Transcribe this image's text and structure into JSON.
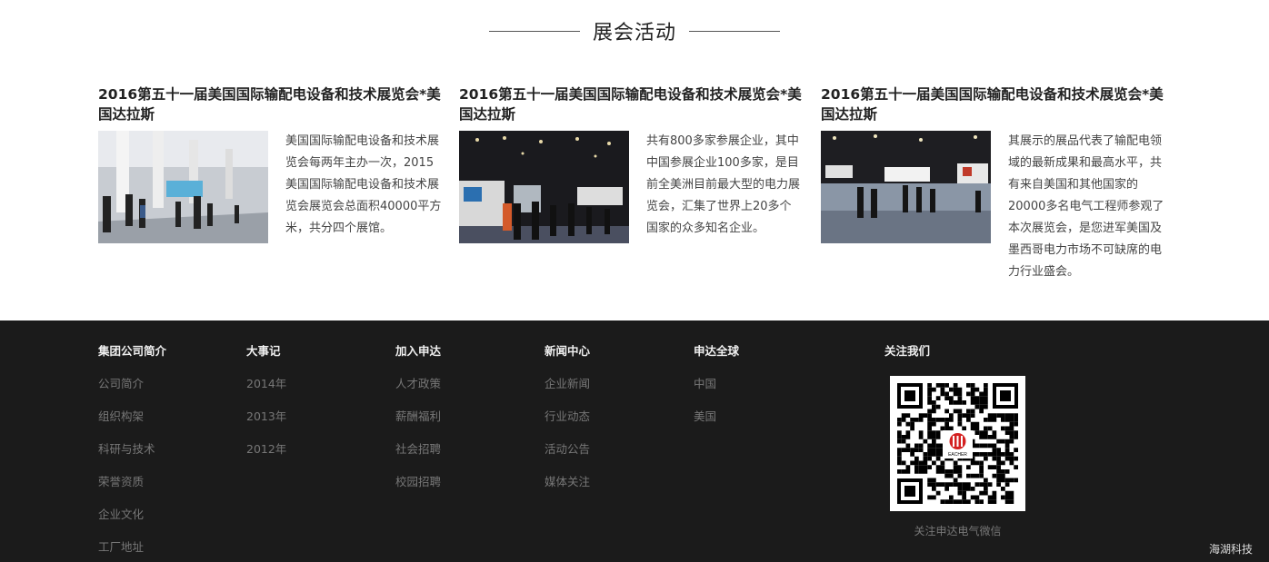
{
  "section": {
    "title": "展会活动"
  },
  "events": [
    {
      "title": "2016第五十一届美国国际输配电设备和技术展览会*美国达拉斯",
      "text": "美国国际输配电设备和技术展览会每两年主办一次，2015美国国际输配电设备和技术展览会展览会总面积40000平方米，共分四个展馆。"
    },
    {
      "title": "2016第五十一届美国国际输配电设备和技术展览会*美国达拉斯",
      "text": "共有800多家参展企业，其中中国参展企业100多家，是目前全美洲目前最大型的电力展览会，汇集了世界上20多个国家的众多知名企业。"
    },
    {
      "title": "2016第五十一届美国国际输配电设备和技术展览会*美国达拉斯",
      "text": "其展示的展品代表了输配电领域的最新成果和最高水平，共有来自美国和其他国家的20000多名电气工程师参观了本次展览会，是您进军美国及墨西哥电力市场不可缺席的电力行业盛会。"
    }
  ],
  "footer": {
    "columns": [
      {
        "title": "集团公司简介",
        "items": [
          "公司简介",
          "组织构架",
          "科研与技术",
          "荣誉资质",
          "企业文化",
          "工厂地址"
        ]
      },
      {
        "title": "大事记",
        "items": [
          "2014年",
          "2013年",
          "2012年"
        ]
      },
      {
        "title": "加入申达",
        "items": [
          "人才政策",
          "薪酬福利",
          "社会招聘",
          "校园招聘"
        ]
      },
      {
        "title": "新闻中心",
        "items": [
          "企业新闻",
          "行业动态",
          "活动公告",
          "媒体关注"
        ]
      },
      {
        "title": "申达全球",
        "items": [
          "中国",
          "美国"
        ]
      }
    ],
    "follow": {
      "title": "关注我们",
      "caption": "关注申达电气微信",
      "qr_logo_text": "EACHER"
    },
    "brand": "海湖科技"
  },
  "colors": {
    "footer_bg": "#1b1b1b",
    "accent_logo": "#d42020"
  }
}
